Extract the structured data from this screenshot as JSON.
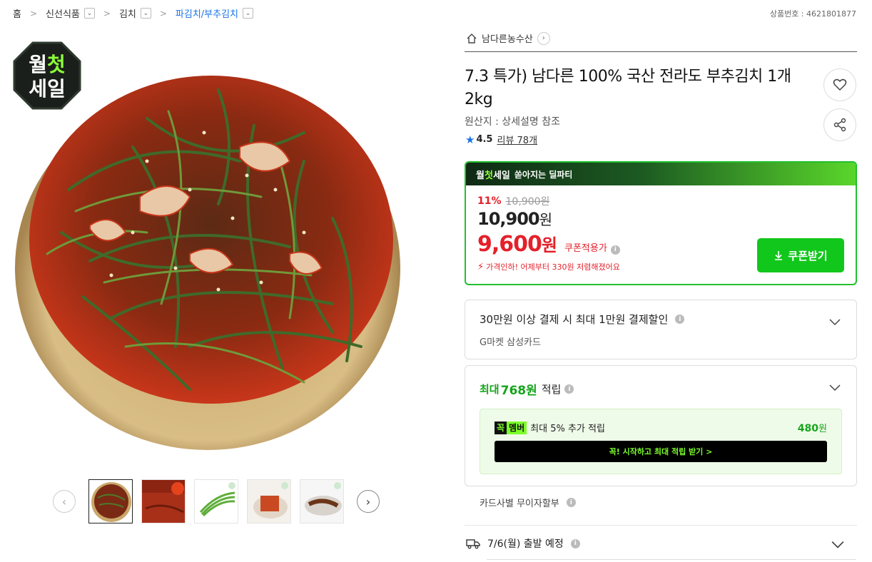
{
  "breadcrumb": {
    "home": "홈",
    "level1": "신선식품",
    "level2": "김치",
    "level3": "파김치/부추김치"
  },
  "product_no": "상품번호 : 4621801877",
  "badge": {
    "line1": "월",
    "line1_hl": "첫",
    "line2": "세일"
  },
  "seller": {
    "name": "남다른농수산"
  },
  "title": "7.3 특가) 남다른 100% 국산 전라도 부추김치 1개 2kg",
  "origin": "원산지 : 상세설명 참조",
  "rating": {
    "score": "4.5",
    "reviews": "리뷰 78개"
  },
  "promo": {
    "w1": "월",
    "w2": "첫",
    "w3": "세일",
    "sub": "쏟아지는 딜파티"
  },
  "price": {
    "discount_pct": "11%",
    "original": "10,900원",
    "current_amt": "10,900",
    "current_unit": "원",
    "coupon_amt": "9,600",
    "coupon_unit": "원",
    "coupon_label": "쿠폰적용가",
    "drop_note": "가격인하! 어제부터 330원 저렴해졌어요",
    "coupon_button": "쿠폰받기"
  },
  "card_payment": {
    "title": "30만원 이상 결제 시 최대 1만원 결제할인",
    "subtitle": "G마켓 삼성카드"
  },
  "points": {
    "prefix": "최대",
    "amount": "768원",
    "suffix": "적립",
    "member_logo_a": "꼭",
    "member_logo_b": "멤버",
    "member_text": "최대 5% 추가 적립",
    "member_points_amt": "480",
    "member_points_unit": "원",
    "member_cta": "꼭! 시작하고 최대 적립 받기 >"
  },
  "installment": "카드사별 무이자할부",
  "delivery": "7/6(월) 출발 예정",
  "colors": {
    "accent_green": "#12c71c",
    "price_red": "#e4202a",
    "link_blue": "#1a73e8"
  }
}
